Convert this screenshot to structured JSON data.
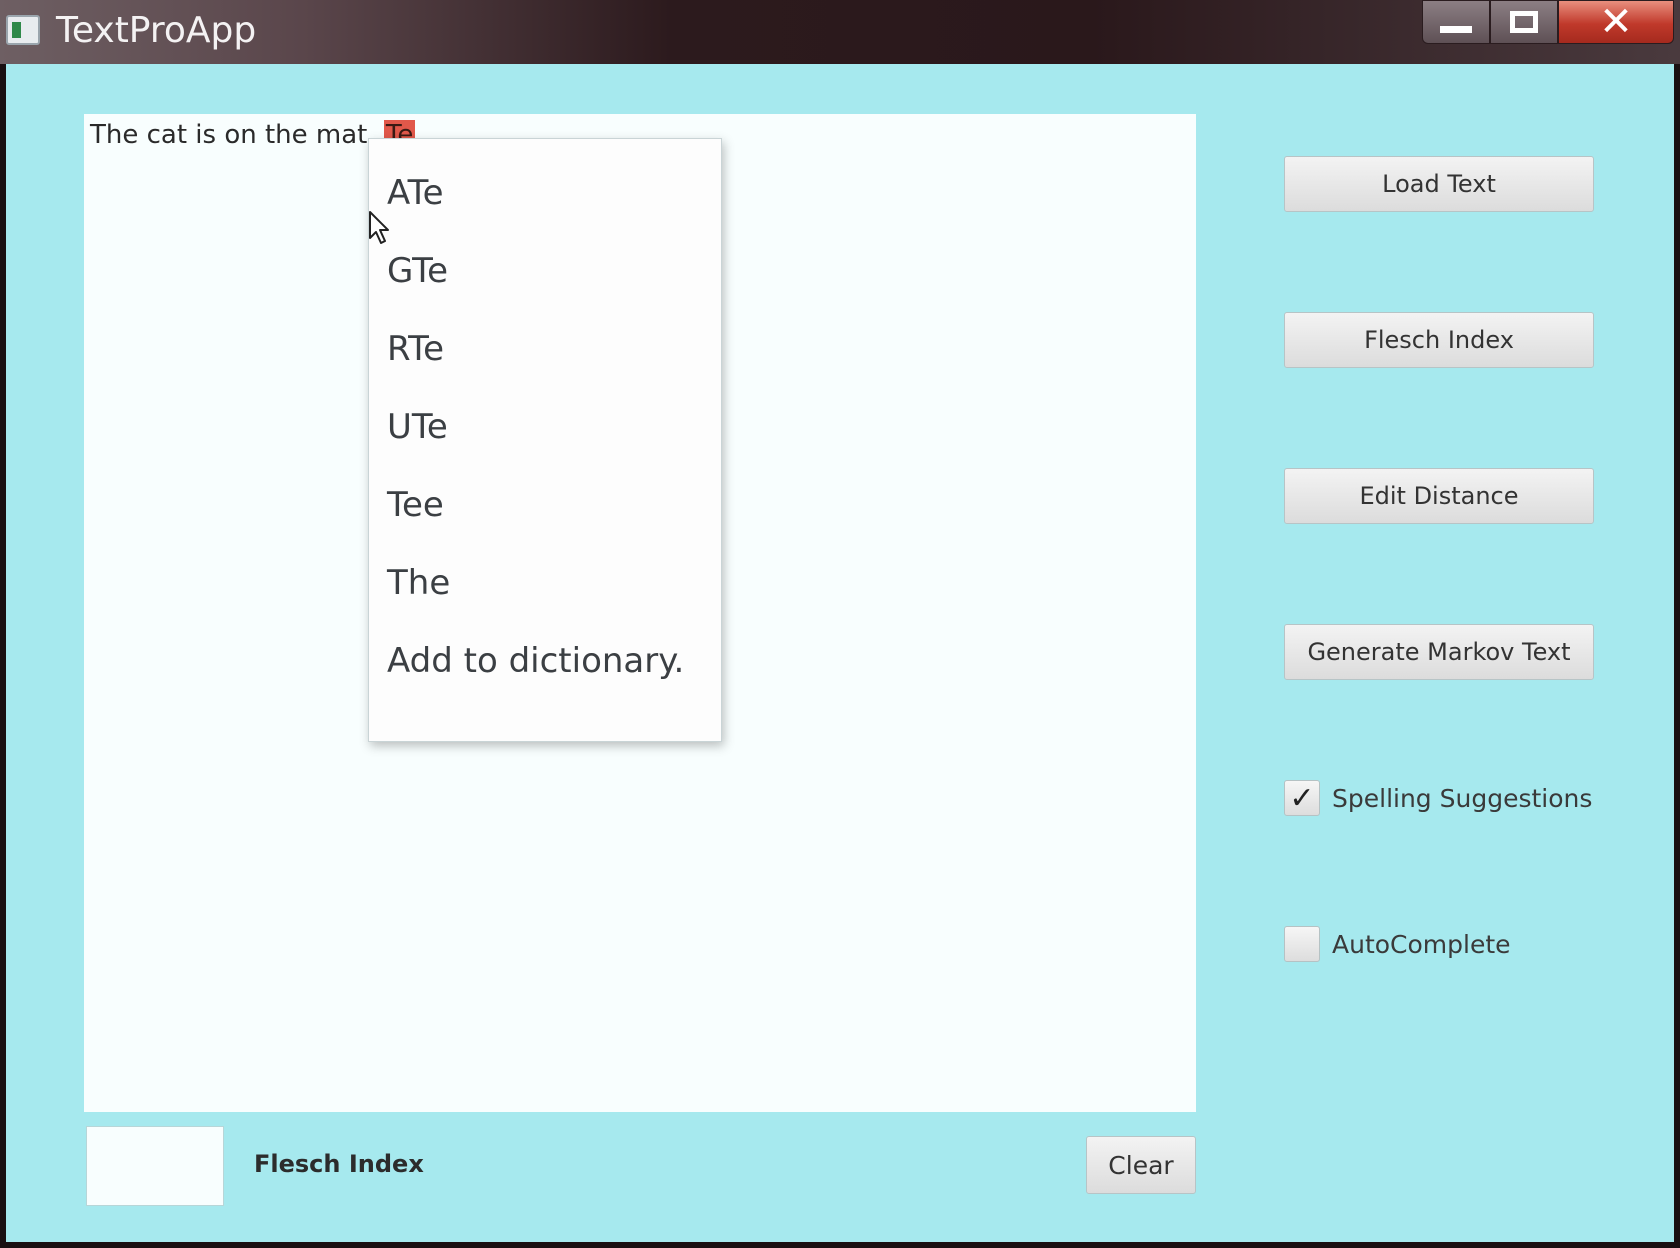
{
  "window": {
    "title": "TextProApp",
    "close_glyph": "✕"
  },
  "editor": {
    "text_before": "The cat is on the mat. ",
    "misspelled_word": "Te"
  },
  "context_menu": {
    "items": [
      "ATe",
      "GTe",
      "RTe",
      "UTe",
      "Tee",
      "The",
      "Add to dictionary."
    ]
  },
  "sidebar": {
    "load_text": "Load Text",
    "flesch_index": "Flesch Index",
    "edit_distance": "Edit Distance",
    "generate_markov": "Generate Markov Text",
    "spelling_suggestions": {
      "label": "Spelling Suggestions",
      "checked": true,
      "mark": "✓"
    },
    "autocomplete": {
      "label": "AutoComplete",
      "checked": false
    }
  },
  "bottom": {
    "flesch_value": "",
    "flesch_label": "Flesch Index",
    "clear": "Clear"
  },
  "colors": {
    "background": "#a6e9ee",
    "misspelled_highlight": "#e1584a",
    "close_button": "#c0392b"
  },
  "icons": [
    "app-icon",
    "minimize-icon",
    "maximize-icon",
    "close-icon",
    "mouse-pointer-icon",
    "checkmark-icon"
  ]
}
